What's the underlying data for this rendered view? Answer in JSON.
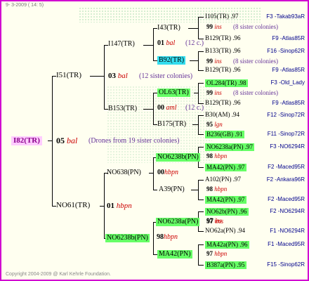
{
  "header": "9-  3-2009 ( 14:  5)",
  "copyright": "Copyright 2004-2009 @ Karl Kehrle Foundation.",
  "gen1": {
    "root": "I82(TR)"
  },
  "gen2": {
    "top": {
      "num": "05",
      "code": "bal",
      "note": "(Drones from 19 sister colonies)"
    },
    "sire": "I51(TR)",
    "dam": "NO61(TR)"
  },
  "gen3": {
    "a": {
      "name": "I147(TR)"
    },
    "a_info": {
      "num": "03",
      "code": "bal",
      "note": "(12 sister colonies)"
    },
    "b": {
      "name": "B153(TR)"
    },
    "c": {
      "name": "NO638(PN)"
    },
    "c_info": {
      "num": "01",
      "code": "hbpn"
    },
    "d": {
      "name": "NO6238b(PN)"
    },
    "d_info": {
      "num": "98",
      "code": "hbpn"
    }
  },
  "gen4": {
    "a1": "I43(TR)",
    "a1_info": {
      "num": "01",
      "code": "bal",
      "note": "(12 c.)"
    },
    "a2": "B92(TR)",
    "b1": "OL63(TR)",
    "b1_info": {
      "num": "00",
      "code": "aml",
      "note": "(12 c.)"
    },
    "b2": "B175(TR)",
    "c1": "NO6238b(PN)",
    "c1_info": {
      "num": "00",
      "code": "hbpn"
    },
    "c2": "A39(PN)",
    "d1": "NO6238a(PN)",
    "d1_info": {
      "num": "97",
      "code": "ins"
    },
    "d2": "MA42(PN)"
  },
  "gen5": [
    {
      "name": "I105(TR) .97",
      "right": "F3 -Takab93aR"
    },
    {
      "num": "99",
      "code": "ins",
      "note": "(8 sister colonies)"
    },
    {
      "name": "B129(TR) .96",
      "right": "F9 -Atlas85R"
    },
    {
      "name": "B133(TR) .96",
      "right": "F16 -Sinop62R"
    },
    {
      "num": "99",
      "code": "ins",
      "note": "(8 sister colonies)"
    },
    {
      "name": "B129(TR) .96",
      "right": "F9 -Atlas85R"
    },
    {
      "name": "OL284(TR) .98",
      "right": "F3 -Old_Lady"
    },
    {
      "num": "99",
      "code": "ins",
      "note": "(8 sister colonies)"
    },
    {
      "name": "B129(TR) .96",
      "right": "F9 -Atlas85R"
    },
    {
      "name": "B30(AM) .94",
      "right": "F12 -Sinop72R"
    },
    {
      "num": "95",
      "code": "lgn"
    },
    {
      "name": "B236(GB) .91",
      "right": "F11 -Sinop72R"
    },
    {
      "name": "NO6238a(PN) .97",
      "right": "F3 -NO6294R"
    },
    {
      "num": "98",
      "code": "hbpn"
    },
    {
      "name": "MA42(PN) .97",
      "right": "F2 -Maced95R"
    },
    {
      "name": "A102(PN) .97",
      "right": "F2 -Ankara96R"
    },
    {
      "num": "98",
      "code": "hbpn"
    },
    {
      "name": "MA42(PN) .97",
      "right": "F2 -Maced95R"
    },
    {
      "name": "NO62b(PN) .96",
      "right": "F2 -NO6294R"
    },
    {
      "num": "97",
      "code": "ins"
    },
    {
      "name": "NO62a(PN) .94",
      "right": "F1 -NO6294R"
    },
    {
      "name": "MA42a(PN) .96",
      "right": "F1 -Maced95R"
    },
    {
      "num": "97",
      "code": "hbpn"
    },
    {
      "name": "B387a(PN) .95",
      "right": "F15 -Sinop62R"
    }
  ],
  "colors": {
    "frame": "#d100d1",
    "highlight_green": "#66ff66",
    "highlight_cyan": "#33ddee",
    "root_bg": "#ffccff",
    "code_red": "#cc0000",
    "ref_blue": "#00008b"
  }
}
